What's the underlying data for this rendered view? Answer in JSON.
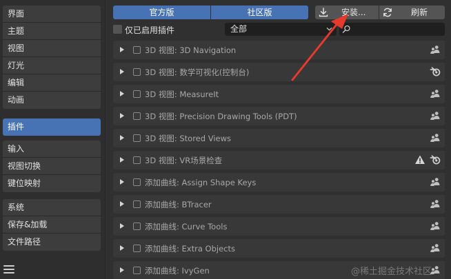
{
  "sidebar": {
    "groups": [
      [
        {
          "label": "界面"
        },
        {
          "label": "主题"
        },
        {
          "label": "视图"
        },
        {
          "label": "灯光"
        },
        {
          "label": "编辑"
        },
        {
          "label": "动画"
        }
      ],
      [
        {
          "label": "插件",
          "active": true
        }
      ],
      [
        {
          "label": "输入"
        },
        {
          "label": "视图切换"
        },
        {
          "label": "键位映射"
        }
      ],
      [
        {
          "label": "系统"
        },
        {
          "label": "保存&加载"
        },
        {
          "label": "文件路径"
        }
      ]
    ],
    "menu_icon": "hamburger-menu-icon"
  },
  "toolbar": {
    "official_label": "官方版",
    "community_label": "社区版",
    "install_label": "安装...",
    "refresh_label": "刷新",
    "install_icon": "download-icon",
    "refresh_icon": "refresh-icon"
  },
  "filter": {
    "enabled_only_label": "仅已启用插件",
    "enabled_only_checked": false,
    "category_value": "全部",
    "search_value": ""
  },
  "addons": [
    {
      "name": "3D 视图: 3D Navigation",
      "icon": "community-icon"
    },
    {
      "name": "3D 视图: 数学可视化(控制台)",
      "icon": "blender-icon"
    },
    {
      "name": "3D 视图: MeasureIt",
      "icon": "community-icon"
    },
    {
      "name": "3D 视图: Precision Drawing Tools (PDT)",
      "icon": "community-icon"
    },
    {
      "name": "3D 视图: Stored Views",
      "icon": "community-icon"
    },
    {
      "name": "3D 视图: VR场景检查",
      "icon": "blender-icon",
      "warning": true
    },
    {
      "name": "添加曲线: Assign Shape Keys",
      "icon": "community-icon"
    },
    {
      "name": "添加曲线: BTracer",
      "icon": "community-icon"
    },
    {
      "name": "添加曲线: Curve Tools",
      "icon": "community-icon"
    },
    {
      "name": "添加曲线: Extra Objects",
      "icon": "community-icon"
    },
    {
      "name": "添加曲线: IvyGen",
      "icon": "community-icon"
    }
  ],
  "colors": {
    "accent": "#4772b3",
    "annotation": "#e63a2e"
  },
  "watermark": "@稀土掘金技术社区"
}
